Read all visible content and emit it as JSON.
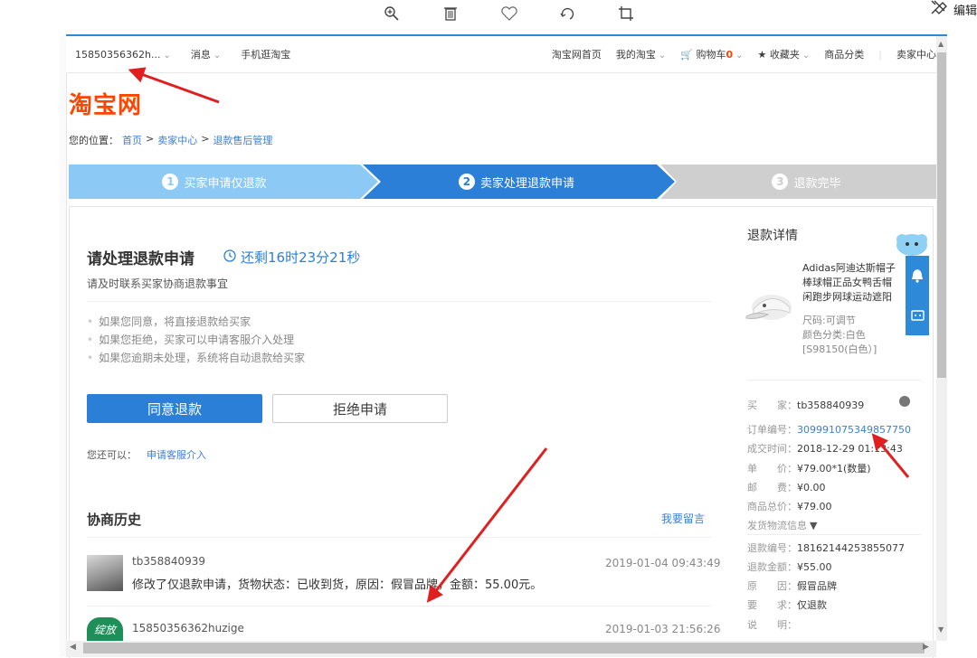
{
  "viewer": {
    "edit_label": "编辑"
  },
  "nav": {
    "account": "15850356362h...",
    "messages": "消息",
    "mobile": "手机逛淘宝",
    "home": "淘宝网首页",
    "my_taobao": "我的淘宝",
    "cart_label": "购物车",
    "cart_count": "0",
    "favorites": "收藏夹",
    "categories": "商品分类",
    "seller_center": "卖家中心"
  },
  "logo": "淘宝网",
  "breadcrumb": {
    "prefix": "您的位置：",
    "home": "首页",
    "seller": "卖家中心",
    "current": "退款售后管理",
    "sep": ">"
  },
  "steps": [
    {
      "num": "1",
      "label": "买家申请仅退款"
    },
    {
      "num": "2",
      "label": "卖家处理退款申请"
    },
    {
      "num": "3",
      "label": "退款完毕"
    }
  ],
  "main": {
    "title": "请处理退款申请",
    "countdown": "还剩16时23分21秒",
    "subtitle": "请及时联系买家协商退款事宜",
    "tips": [
      "如果您同意，将直接退款给买家",
      "如果您拒绝，买家可以申请客服介入处理",
      "如果您逾期未处理，系统将自动退款给买家"
    ],
    "agree_button": "同意退款",
    "reject_button": "拒绝申请",
    "also_prefix": "您还可以：",
    "also_link": "申请客服介入",
    "history_title": "协商历史",
    "leave_message": "我要留言",
    "history": [
      {
        "user": "tb358840939",
        "time": "2019-01-04 09:43:49",
        "text": "修改了仅退款申请，货物状态：已收到货，原因：假冒品牌，金额：55.00元。"
      },
      {
        "user": "15850356362huzige",
        "time": "2019-01-03 21:56:26",
        "text": "",
        "badge": "绽放"
      }
    ]
  },
  "side": {
    "title": "退款详情",
    "product_name": "Adidas阿迪达斯帽子棒球帽正品女鸭舌帽休闲跑步网球运动遮阳帽",
    "product_lines": [
      "Adidas阿迪达斯帽子",
      "棒球帽正品女鸭舌帽",
      "闲跑步网球运动遮阳"
    ],
    "size": "尺码:可调节",
    "color": "颜色分类:白色",
    "sku": "[S98150(白色）]",
    "buyer_label": "买　　家：",
    "buyer": "tb358840939",
    "order_label": "订单编号：",
    "order_no": "309991075349857750",
    "deal_time_label": "成交时间：",
    "deal_time": "2018-12-29 01:13:43",
    "price_label": "单　　价：",
    "price": "¥79.00*1(数量)",
    "postage_label": "邮　　费：",
    "postage": "¥0.00",
    "total_label": "商品总价：",
    "total": "¥79.00",
    "logistics": "发货物流信息",
    "refund_no_label": "退款编号：",
    "refund_no": "18162144253855077",
    "refund_amount_label": "退款金额：",
    "refund_amount": "¥55.00",
    "reason_label": "原　　因：",
    "reason": "假冒品牌",
    "request_label": "要　　求：",
    "request": "仅退款",
    "desc_label": "说　　明："
  },
  "colors": {
    "brand_orange": "#ff4400",
    "step_done": "#8ccaf5",
    "step_active": "#2c7fd6",
    "step_pending": "#cfcfcf",
    "annotation_red": "#e02020",
    "link_blue": "#3c7ed6"
  }
}
